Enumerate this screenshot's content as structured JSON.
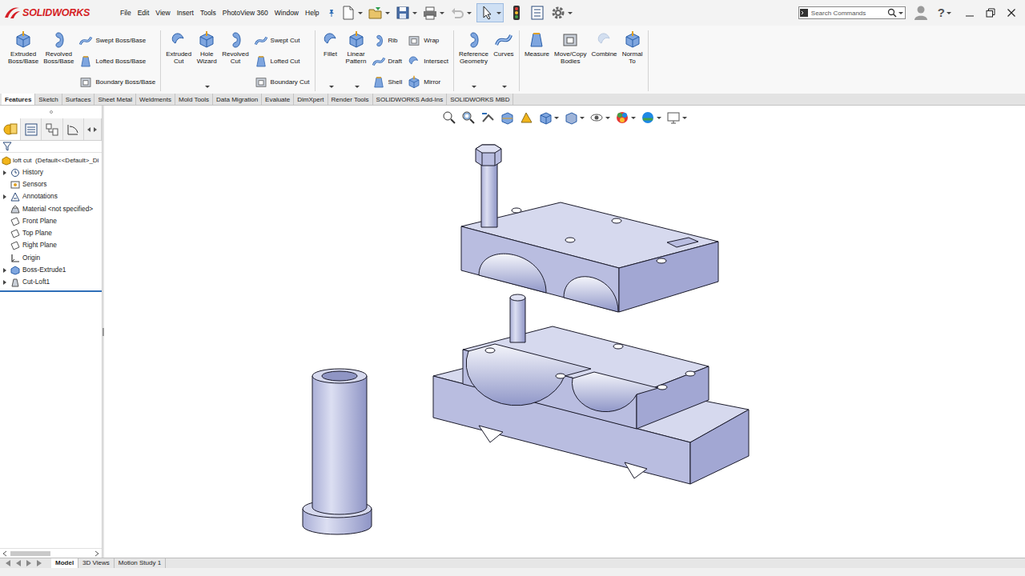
{
  "app": {
    "logo": "SOLIDWORKS"
  },
  "menu": [
    {
      "label": "File"
    },
    {
      "label": "Edit"
    },
    {
      "label": "View"
    },
    {
      "label": "Insert"
    },
    {
      "label": "Tools"
    },
    {
      "label": "PhotoView 360"
    },
    {
      "label": "Window"
    },
    {
      "label": "Help"
    }
  ],
  "search": {
    "placeholder": "Search Commands"
  },
  "help": {
    "label": "?"
  },
  "ribbon": {
    "groups": [
      {
        "items": [
          {
            "label": "Extruded Boss/Base",
            "kind": "large",
            "dropdown": false,
            "disabled": false
          },
          {
            "label": "Revolved Boss/Base",
            "kind": "large",
            "dropdown": false,
            "disabled": false
          },
          {
            "label": "Swept Boss/Base",
            "kind": "small",
            "dropdown": false,
            "disabled": false
          },
          {
            "label": "Lofted Boss/Base",
            "kind": "small",
            "dropdown": false,
            "disabled": false
          },
          {
            "label": "Boundary Boss/Base",
            "kind": "small",
            "dropdown": false,
            "disabled": false
          }
        ]
      },
      {
        "items": [
          {
            "label": "Extruded Cut",
            "kind": "large",
            "dropdown": false,
            "disabled": false
          },
          {
            "label": "Hole Wizard",
            "kind": "large",
            "dropdown": true,
            "disabled": false
          },
          {
            "label": "Revolved Cut",
            "kind": "large",
            "dropdown": false,
            "disabled": false
          },
          {
            "label": "Swept Cut",
            "kind": "small",
            "dropdown": false,
            "disabled": false
          },
          {
            "label": "Lofted Cut",
            "kind": "small",
            "dropdown": false,
            "disabled": false
          },
          {
            "label": "Boundary Cut",
            "kind": "small",
            "dropdown": false,
            "disabled": false
          }
        ]
      },
      {
        "items": [
          {
            "label": "Fillet",
            "kind": "large",
            "dropdown": true,
            "disabled": false
          },
          {
            "label": "Linear Pattern",
            "kind": "large",
            "dropdown": true,
            "disabled": false
          },
          {
            "label": "Rib",
            "kind": "small",
            "dropdown": false,
            "disabled": false
          },
          {
            "label": "Draft",
            "kind": "small",
            "dropdown": false,
            "disabled": false
          },
          {
            "label": "Shell",
            "kind": "small",
            "dropdown": false,
            "disabled": false
          },
          {
            "label": "Wrap",
            "kind": "small",
            "dropdown": false,
            "disabled": false
          },
          {
            "label": "Intersect",
            "kind": "small",
            "dropdown": false,
            "disabled": false
          },
          {
            "label": "Mirror",
            "kind": "small",
            "dropdown": false,
            "disabled": false
          }
        ]
      },
      {
        "items": [
          {
            "label": "Reference Geometry",
            "kind": "large",
            "dropdown": true,
            "disabled": false
          },
          {
            "label": "Curves",
            "kind": "large",
            "dropdown": true,
            "disabled": false
          }
        ]
      },
      {
        "items": [
          {
            "label": "Measure",
            "kind": "large",
            "dropdown": false,
            "disabled": false
          },
          {
            "label": "Move/Copy Bodies",
            "kind": "large",
            "dropdown": false,
            "disabled": false
          },
          {
            "label": "Combine",
            "kind": "large",
            "dropdown": false,
            "disabled": true
          },
          {
            "label": "Normal To",
            "kind": "large",
            "dropdown": false,
            "disabled": false
          }
        ]
      }
    ]
  },
  "tabs": [
    {
      "label": "Features",
      "selected": true
    },
    {
      "label": "Sketch",
      "selected": false
    },
    {
      "label": "Surfaces",
      "selected": false
    },
    {
      "label": "Sheet Metal",
      "selected": false
    },
    {
      "label": "Weldments",
      "selected": false
    },
    {
      "label": "Mold Tools",
      "selected": false
    },
    {
      "label": "Data Migration",
      "selected": false
    },
    {
      "label": "Evaluate",
      "selected": false
    },
    {
      "label": "DimXpert",
      "selected": false
    },
    {
      "label": "Render Tools",
      "selected": false
    },
    {
      "label": "SOLIDWORKS Add-Ins",
      "selected": false
    },
    {
      "label": "SOLIDWORKS MBD",
      "selected": false
    }
  ],
  "tree": {
    "root": "loft cut  (Default<<Default>_Di",
    "items": [
      {
        "label": "History",
        "expandable": true
      },
      {
        "label": "Sensors",
        "expandable": false
      },
      {
        "label": "Annotations",
        "expandable": true
      },
      {
        "label": "Material <not specified>",
        "expandable": false
      },
      {
        "label": "Front Plane",
        "expandable": false
      },
      {
        "label": "Top Plane",
        "expandable": false
      },
      {
        "label": "Right Plane",
        "expandable": false
      },
      {
        "label": "Origin",
        "expandable": false
      },
      {
        "label": "Boss-Extrude1",
        "expandable": true
      },
      {
        "label": "Cut-Loft1",
        "expandable": true
      }
    ]
  },
  "bottom_tabs": [
    {
      "label": "Model",
      "selected": true
    },
    {
      "label": "3D Views",
      "selected": false
    },
    {
      "label": "Motion Study 1",
      "selected": false
    }
  ]
}
